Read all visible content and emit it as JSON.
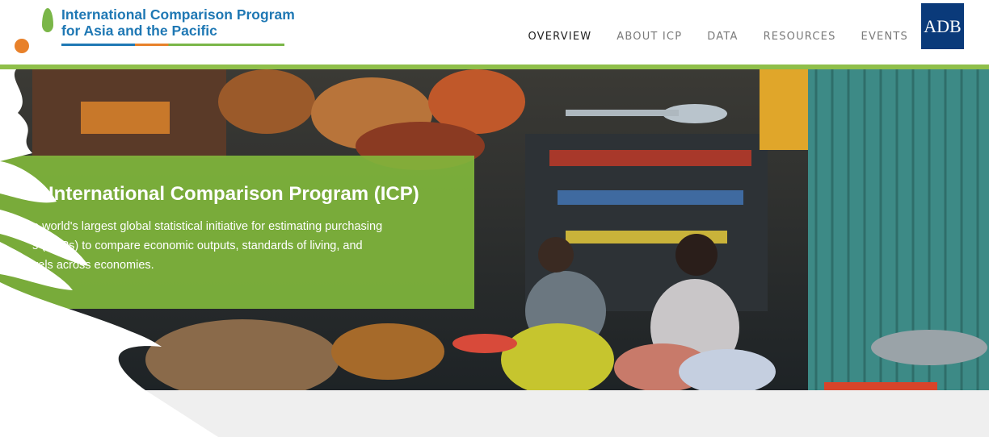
{
  "header": {
    "logo_line1": "International Comparison Program",
    "logo_line2": "for Asia and the Pacific",
    "adb_label": "ADB"
  },
  "nav": {
    "items": [
      "OVERVIEW",
      "ABOUT ICP",
      "DATA",
      "RESOURCES",
      "EVENTS"
    ],
    "active": "OVERVIEW"
  },
  "hero": {
    "title": "e International Comparison Program (ICP)",
    "body_line1": "e world's largest global statistical initiative for estimating purchasing",
    "body_line2": "s (PPPs) to compare economic outputs, standards of living, and",
    "body_line3": "vels across economies."
  },
  "colors": {
    "brand_blue": "#1f78b4",
    "brand_green": "#8fbf4a",
    "brand_orange": "#e8812a",
    "adb_navy": "#0a3a7a"
  }
}
